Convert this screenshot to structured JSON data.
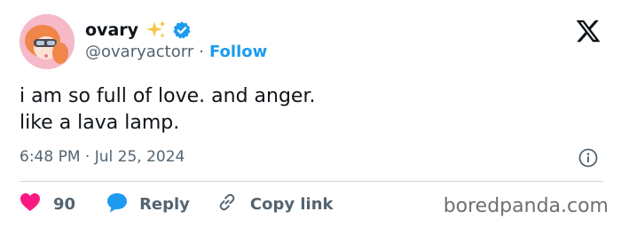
{
  "tweet": {
    "display_name": "ovary",
    "sparkle_icon": "sparkles-icon",
    "verified_icon": "verified-badge-icon",
    "handle": "@ovaryactorr",
    "separator": "·",
    "follow_label": "Follow",
    "text": "i am so full of love. and anger.\nlike a lava lamp.",
    "timestamp": "6:48 PM · Jul 25, 2024"
  },
  "actions": {
    "like_count": "90",
    "reply_label": "Reply",
    "copy_link_label": "Copy link"
  },
  "watermark": "boredpanda.com",
  "colors": {
    "accent": "#1d9bf0",
    "like": "#f91880",
    "text": "#0f1419",
    "muted": "#536471",
    "sparkle": "#f4c542",
    "divider": "#cfd9de"
  }
}
